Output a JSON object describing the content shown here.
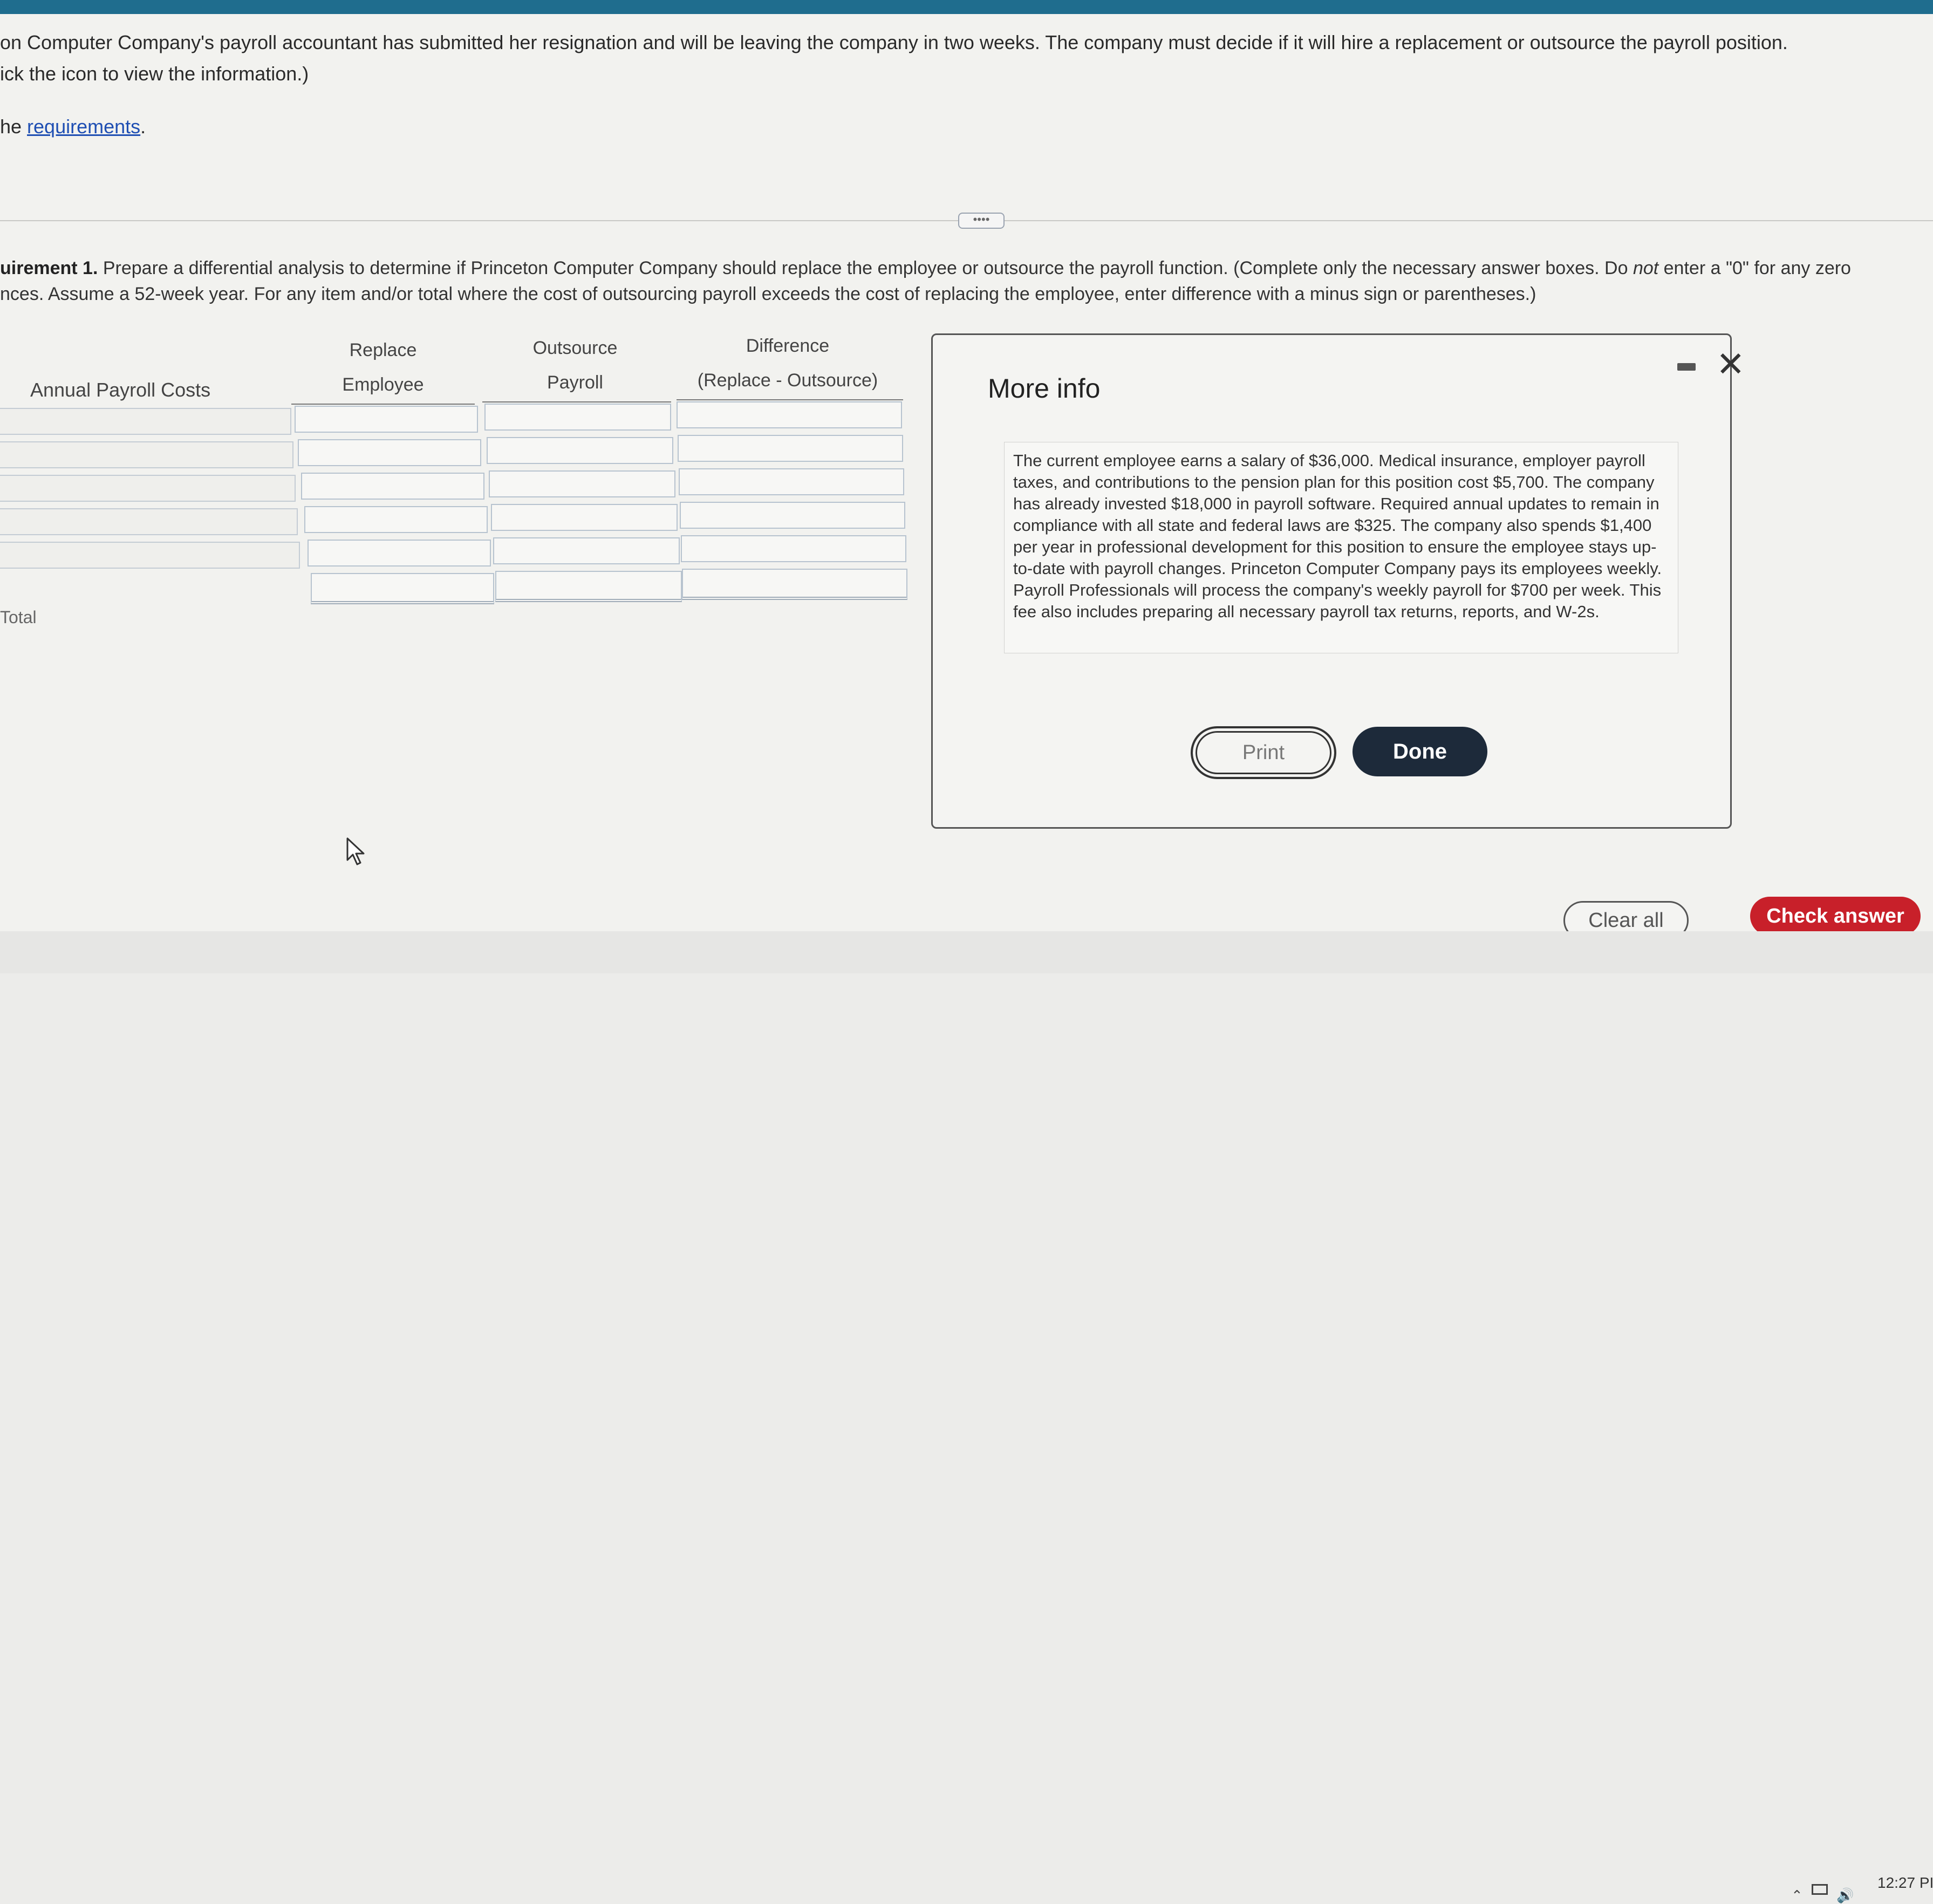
{
  "intro": {
    "line1": "on Computer Company's payroll accountant has submitted her resignation and will be leaving the company in two weeks. The company must decide if it will hire a replacement or outsource the payroll position.",
    "line2": "ick the icon to view the information.)",
    "line3_prefix": "he ",
    "requirements_link": "requirements",
    "line3_suffix": "."
  },
  "more_pill": "••••",
  "requirement": {
    "label": "uirement 1.",
    "text1": " Prepare a differential analysis to determine if Princeton Computer Company should replace the employee or outsource the payroll function. (Complete only the necessary answer boxes. Do ",
    "not": "not",
    "text2": " enter a \"0\" for any zero",
    "line2": "nces. Assume a 52-week year. For any item and/or total where the cost of outsourcing payroll exceeds the cost of replacing the employee, enter difference with a minus sign or parentheses.)"
  },
  "table": {
    "col_label": "Annual Payroll Costs",
    "col1_line1": "Replace",
    "col1_line2": "Employee",
    "col2_line1": "Outsource",
    "col2_line2": "Payroll",
    "col3_line1": "Difference",
    "col3_line2": "(Replace - Outsource)",
    "total_label": "Total",
    "rows": 5
  },
  "dialog": {
    "title": "More info",
    "info": "The current employee earns a salary of $36,000. Medical insurance, employer payroll taxes, and contributions to the pension plan for this position cost $5,700. The company has already invested $18,000 in payroll software. Required annual updates to remain in compliance with all state and federal laws are $325. The company also spends $1,400 per year in professional development for this position to ensure the employee stays up-to-date with payroll changes. Princeton Computer Company pays its employees weekly. Payroll Professionals will process the company's weekly payroll for $700 per week. This fee also includes preparing all necessary payroll tax returns, reports, and W-2s.",
    "print_label": "Print",
    "done_label": "Done",
    "close_glyph": "✕"
  },
  "actions": {
    "clear_label": "Clear all",
    "check_label": "Check answer"
  },
  "taskbar": {
    "clock": "12:27 PI"
  },
  "colors": {
    "accent_red": "#c8202a",
    "done_dark": "#1d2a3a",
    "link_blue": "#1f4fb3",
    "topbar": "#1f6d8e"
  }
}
